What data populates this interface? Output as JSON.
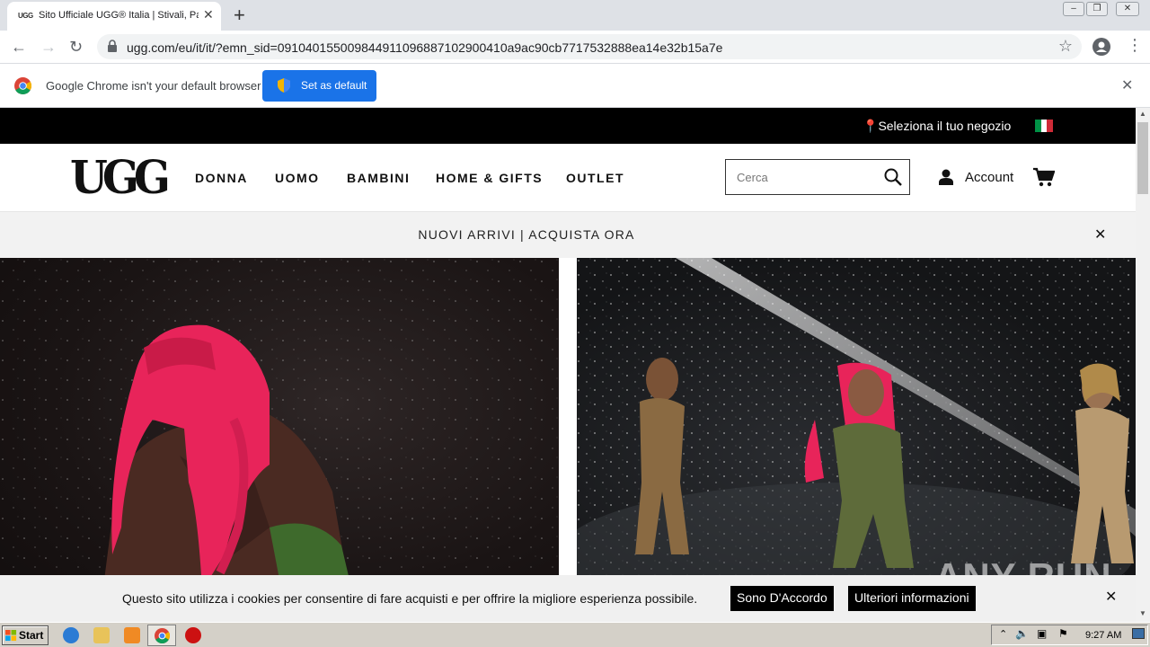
{
  "browser": {
    "tab_title": "Sito Ufficiale UGG® Italia | Stivali, Pantofole",
    "tab_favicon": "UGG",
    "url": "ugg.com/eu/it/it/?emn_sid=091040155009844911096887102900410a9ac90cb7717532888ea14e32b15a7e",
    "infobar_message": "Google Chrome isn't your default browser",
    "set_default_label": "Set as default"
  },
  "site": {
    "store_selector": "Seleziona il tuo negozio",
    "logo_text": "UGG",
    "nav": [
      "DONNA",
      "UOMO",
      "BAMBINI",
      "HOME & GIFTS",
      "OUTLET"
    ],
    "search_placeholder": "Cerca",
    "account_label": "Account",
    "promo_text": "NUOVI ARRIVI | ACQUISTA ORA",
    "flag_colors": [
      "#009246",
      "#ffffff",
      "#ce2b37"
    ]
  },
  "cookie": {
    "message": "Questo sito utilizza i cookies per consentire di fare acquisti e per offrire la migliore esperienza possibile.",
    "accept_label": "Sono D'Accordo",
    "more_label": "Ulteriori informazioni"
  },
  "watermark": "ANY RUN",
  "taskbar": {
    "start_label": "Start",
    "clock": "9:27 AM"
  },
  "colors": {
    "accent": "#1a73e8",
    "hair_pink": "#e8245a"
  }
}
